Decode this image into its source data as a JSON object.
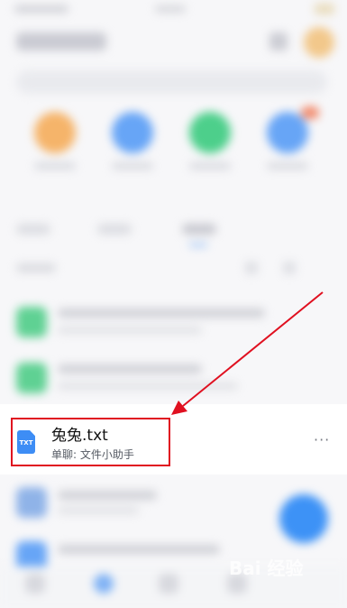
{
  "file_row": {
    "icon_text": "TXT",
    "name": "兔兔.txt",
    "subtitle": "单聊: 文件小助手",
    "more": "···"
  },
  "watermark": {
    "text": "Bai 经验"
  },
  "colors": {
    "accent": "#3d8df5",
    "annotation": "#e01020"
  },
  "icons": [
    "txt-file-icon",
    "more-icon",
    "floating-action-icon"
  ]
}
